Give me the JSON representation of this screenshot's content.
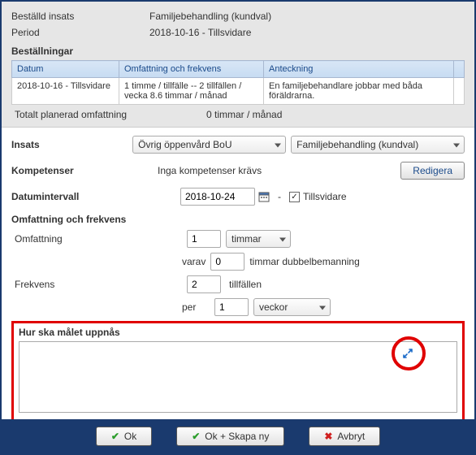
{
  "top": {
    "ordered_label": "Beställd insats",
    "ordered_value": "Familjebehandling (kundval)",
    "period_label": "Period",
    "period_value": "2018-10-16 - Tillsvidare",
    "orders_header": "Beställningar",
    "table": {
      "cols": {
        "date": "Datum",
        "scope": "Omfattning och frekvens",
        "note": "Anteckning"
      },
      "rows": [
        {
          "date": "2018-10-16 - Tillsvidare",
          "scope": "1 timme / tillfälle -- 2 tillfällen / vecka  8.6 timmar / månad",
          "note": "En familjebehandlare jobbar med båda föräldrarna."
        }
      ]
    },
    "totals_label": "Totalt planerad omfattning",
    "totals_value": "0 timmar / månad"
  },
  "form": {
    "insats_label": "Insats",
    "insats_select1": "Övrig öppenvård BoU",
    "insats_select2": "Familjebehandling (kundval)",
    "kompetenser_label": "Kompetenser",
    "kompetenser_text": "Inga kompetenser krävs",
    "edit_btn": "Redigera",
    "date_label": "Datumintervall",
    "date_value": "2018-10-24",
    "tillsvidare_label": "Tillsvidare",
    "tillsvidare_checked": true,
    "scope_header": "Omfattning och frekvens",
    "scope_label": "Omfattning",
    "scope_value": "1",
    "scope_unit": "timmar",
    "varav_label": "varav",
    "varav_value": "0",
    "varav_suffix": "timmar dubbelbemanning",
    "frekv_label": "Frekvens",
    "frekv_value": "2",
    "frekv_unit": "tillfällen",
    "per_label": "per",
    "per_value": "1",
    "per_unit": "veckor",
    "goal_header": "Hur ska målet uppnås"
  },
  "buttons": {
    "ok": "Ok",
    "ok_new": "Ok + Skapa ny",
    "cancel": "Avbryt"
  }
}
